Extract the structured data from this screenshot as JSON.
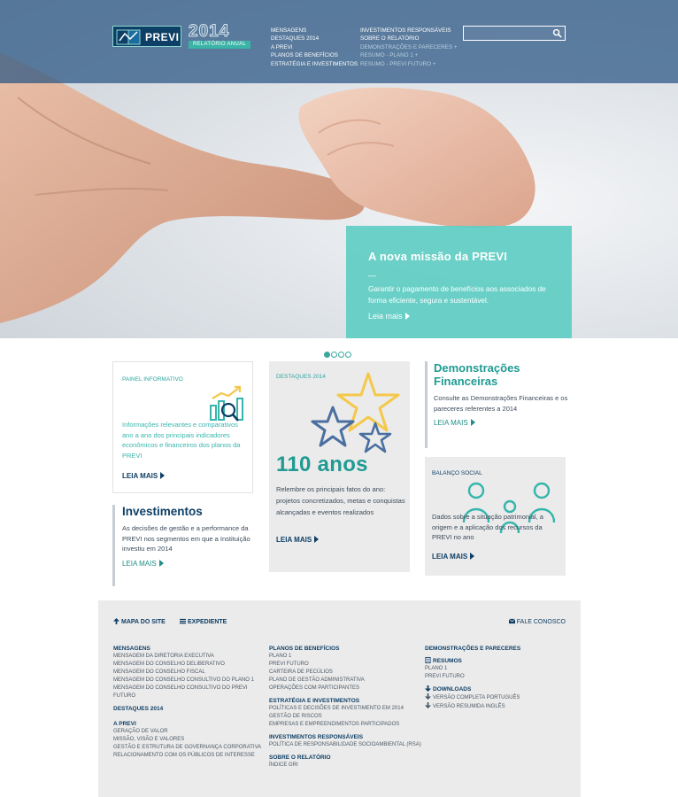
{
  "header": {
    "logo_text": "PREVI",
    "logo_year": "2014",
    "logo_subtitle": "RELATÓRIO ANUAL",
    "nav_left": [
      "MENSAGENS",
      "DESTAQUES 2014",
      "A PREVI",
      "PLANOS DE BENEFÍCIOS",
      "ESTRATÉGIA E INVESTIMENTOS"
    ],
    "nav_right": [
      "INVESTIMENTOS RESPONSÁVEIS",
      "SOBRE O RELATÓRIO",
      "DEMONSTRAÇÕES E PARECERES +",
      "RESUMO - PLANO 1 +",
      "RESUMO - PREVI FUTURO +"
    ],
    "search": {
      "value": "",
      "placeholder": ""
    }
  },
  "hero": {
    "title": "A nova missão da PREVI",
    "dash": "—",
    "text": "Garantir o pagamento de benefícios aos associados de forma eficiente, segura e sustentável.",
    "more": "Leia mais",
    "slides": 4,
    "active_slide": 1
  },
  "cards": {
    "painel": {
      "label": "PAINEL INFORMATIVO",
      "desc": "Informações relevantes e comparativos ano a ano dos principais indicadores econômicos e financeiros dos planos da PREVI",
      "more": "LEIA MAIS"
    },
    "investimentos": {
      "title": "Investimentos",
      "desc": "As decisões de gestão e a performance da PREVI nos segmentos em que a Instituição investiu em 2014",
      "more": "LEIA MAIS"
    },
    "destaques": {
      "label": "DESTAQUES 2014",
      "big": "110 anos",
      "desc": "Relembre os principais fatos do ano: projetos concretizados, metas e conquistas alcançadas e eventos realizados",
      "more": "LEIA MAIS"
    },
    "demonstracoes": {
      "title": "Demonstrações Financeiras",
      "desc": "Consulte as Demonstrações Financeiras e os pareceres referentes a 2014",
      "more": "LEIA MAIS"
    },
    "balanco": {
      "label": "BALANÇO SOCIAL",
      "desc": "Dados sobre a situação patrimonial, a origem e a aplicação dos recursos da PREVI no ano",
      "more": "LEIA MAIS"
    }
  },
  "footer": {
    "sitemap": "MAPA DO SITE",
    "expediente": "EXPEDIENTE",
    "contact": "FALE CONOSCO",
    "col1": {
      "mensagens": "MENSAGENS",
      "mensagens_items": [
        "MENSAGEM DA DIRETORIA EXECUTIVA",
        "MENSAGEM DO CONSELHO DELIBERATIVO",
        "MENSAGEM DO CONSELHO FISCAL",
        "MENSAGEM DO CONSELHO CONSULTIVO DO PLANO 1",
        "MENSAGEM DO CONSELHO CONSULTIVO DO PREVI",
        "FUTURO"
      ],
      "destaques": "DESTAQUES 2014",
      "aprevi": "A PREVI",
      "aprevi_items": [
        "GERAÇÃO DE VALOR",
        "MISSÃO, VISÃO E VALORES",
        "GESTÃO E ESTRUTURA DE GOVERNANÇA CORPORATIVA",
        "RELACIONAMENTO COM OS PÚBLICOS DE INTERESSE"
      ]
    },
    "col2": {
      "planos": "PLANOS DE BENEFÍCIOS",
      "planos_items": [
        "PLANO 1",
        "PREVI FUTURO",
        "CARTEIRA DE PECÚLIOS",
        "PLANO DE GESTÃO ADMINISTRATIVA",
        "OPERAÇÕES COM PARTICIPANTES"
      ],
      "estrategia": "ESTRATÉGIA E INVESTIMENTOS",
      "estrategia_items": [
        "POLÍTICAS E DECISÕES DE INVESTIMENTO EM 2014",
        "GESTÃO DE RISCOS",
        "EMPRESAS E EMPREENDIMENTOS PARTICIPADOS"
      ],
      "responsaveis": "INVESTIMENTOS RESPONSÁVEIS",
      "responsaveis_items": [
        "POLÍTICA DE RESPONSABILIDADE SOCIOAMBIENTAL (RSA)"
      ],
      "sobre": "SOBRE O RELATÓRIO",
      "sobre_items": [
        "ÍNDICE GRI"
      ]
    },
    "col3": {
      "demonstracoes": "DEMONSTRAÇÕES E PARECERES",
      "resumos": "RESUMOS",
      "resumos_items": [
        "PLANO 1",
        "PREVI FUTURO"
      ],
      "downloads": "DOWNLOADS",
      "downloads_items": [
        "VERSÃO COMPLETA PORTUGUÊS",
        "VERSÃO RESUMIDA INGLÊS"
      ]
    }
  },
  "colors": {
    "navy": "#0e3f66",
    "teal": "#1f9b93",
    "teal_light": "#60cdc3",
    "header_overlay": "#285582",
    "star_yellow": "#f4c84a",
    "star_blue": "#4a6fa0"
  }
}
